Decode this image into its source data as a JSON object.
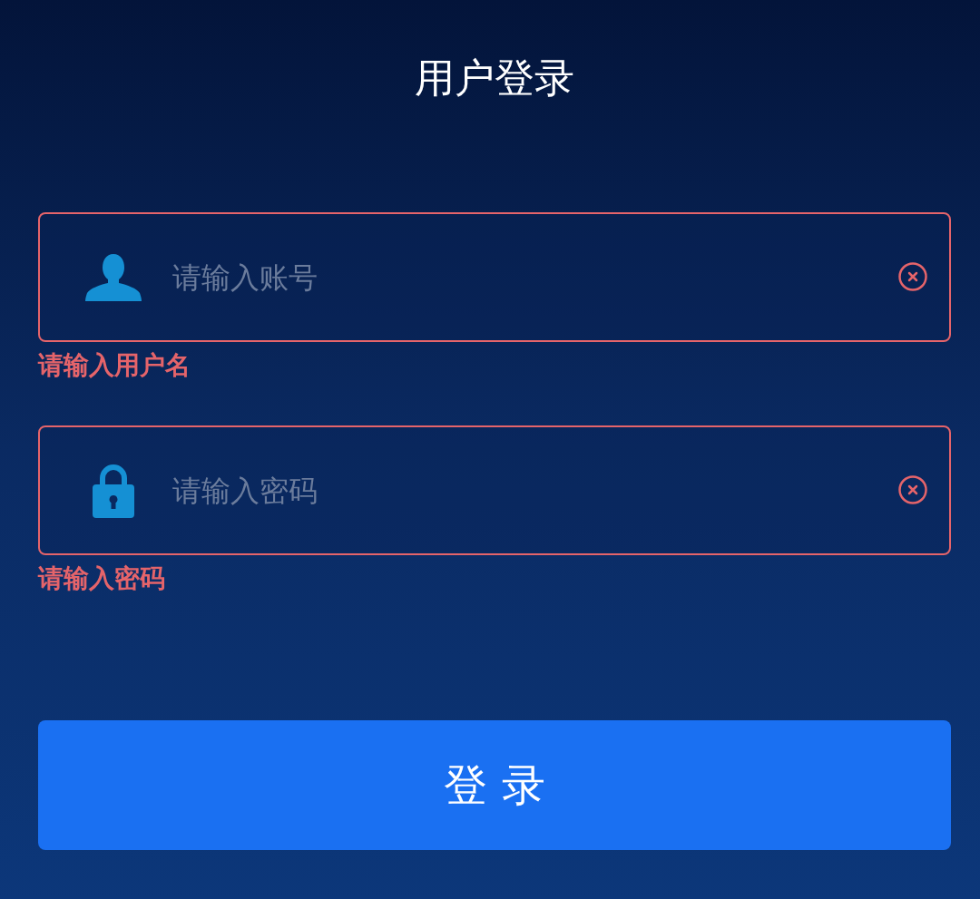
{
  "title": "用户登录",
  "fields": [
    {
      "kind": "account",
      "placeholder": "请输入账号",
      "error": true,
      "error_message": "请输入用户名"
    },
    {
      "kind": "password",
      "placeholder": "请输入密码",
      "error": true,
      "error_message": "请输入密码"
    }
  ],
  "submit_button": {
    "label": "登 录"
  }
}
